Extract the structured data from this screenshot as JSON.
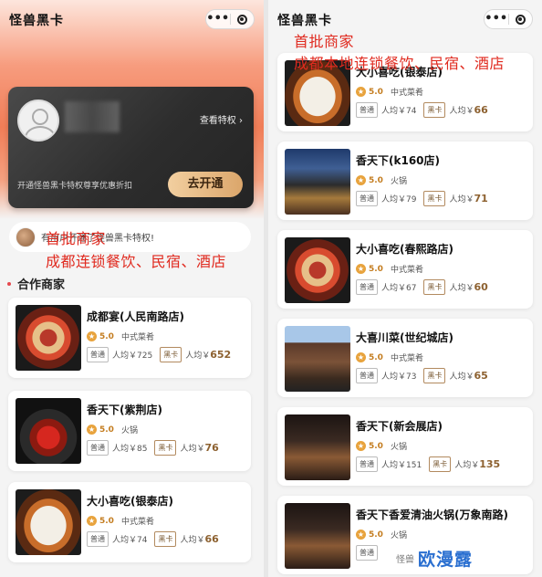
{
  "left": {
    "app_title": "怪兽黑卡",
    "capsule": {
      "more": "•••",
      "close_icon": "target-icon"
    },
    "card": {
      "view_benefits": "查看特权 ›",
      "desc": "开通怪兽黑卡特权尊享优惠折扣",
      "open_button": "去开通"
    },
    "notice": "有用户开通了怪兽黑卡特权!",
    "overlay": {
      "line1": "首批商家",
      "line2": "成都连锁餐饮、民宿、酒店"
    },
    "section_title": "合作商家",
    "merchants": [
      {
        "name": "成都宴(人民南路店)",
        "rating": "5.0",
        "category": "中式菜肴",
        "normal_tag": "普通",
        "normal_price": "人均￥725",
        "black_tag": "黑卡",
        "black_prefix": "人均￥",
        "black_price": "652"
      },
      {
        "name": "香天下(紫荆店)",
        "rating": "5.0",
        "category": "火锅",
        "normal_tag": "普通",
        "normal_price": "人均￥85",
        "black_tag": "黑卡",
        "black_prefix": "人均￥",
        "black_price": "76"
      },
      {
        "name": "大小喜吃(银泰店)",
        "rating": "5.0",
        "category": "中式菜肴",
        "normal_tag": "普通",
        "normal_price": "人均￥74",
        "black_tag": "黑卡",
        "black_prefix": "人均￥",
        "black_price": "66"
      }
    ]
  },
  "right": {
    "app_title": "怪兽黑卡",
    "capsule": {
      "more": "•••",
      "close_icon": "target-icon"
    },
    "overlay": {
      "line1": "首批商家",
      "line2": "成都本地连锁餐饮、民宿、酒店"
    },
    "merchants": [
      {
        "name": "大小喜吃(银泰店)",
        "rating": "5.0",
        "category": "中式菜肴",
        "normal_tag": "普通",
        "normal_price": "人均￥74",
        "black_tag": "黑卡",
        "black_prefix": "人均￥",
        "black_price": "66"
      },
      {
        "name": "香天下(k160店)",
        "rating": "5.0",
        "category": "火锅",
        "normal_tag": "普通",
        "normal_price": "人均￥79",
        "black_tag": "黑卡",
        "black_prefix": "人均￥",
        "black_price": "71"
      },
      {
        "name": "大小喜吃(春熙路店)",
        "rating": "5.0",
        "category": "中式菜肴",
        "normal_tag": "普通",
        "normal_price": "人均￥67",
        "black_tag": "黑卡",
        "black_prefix": "人均￥",
        "black_price": "60"
      },
      {
        "name": "大喜川菜(世纪城店)",
        "rating": "5.0",
        "category": "中式菜肴",
        "normal_tag": "普通",
        "normal_price": "人均￥73",
        "black_tag": "黑卡",
        "black_prefix": "人均￥",
        "black_price": "65"
      },
      {
        "name": "香天下(新会展店)",
        "rating": "5.0",
        "category": "火锅",
        "normal_tag": "普通",
        "normal_price": "人均￥151",
        "black_tag": "黑卡",
        "black_prefix": "人均￥",
        "black_price": "135"
      },
      {
        "name": "香天下香爱清油火锅(万象南路)",
        "rating": "5.0",
        "category": "火锅",
        "normal_tag": "普通",
        "normal_price": "",
        "black_tag": "",
        "black_prefix": "",
        "black_price": ""
      }
    ]
  },
  "watermark": {
    "small": "怪兽",
    "big": "欧漫露"
  },
  "colors": {
    "accent_orange": "#f07d57",
    "gold_button": "#dba66b",
    "overlay_red": "#e02a1f",
    "rating_gold": "#e8a33d"
  }
}
